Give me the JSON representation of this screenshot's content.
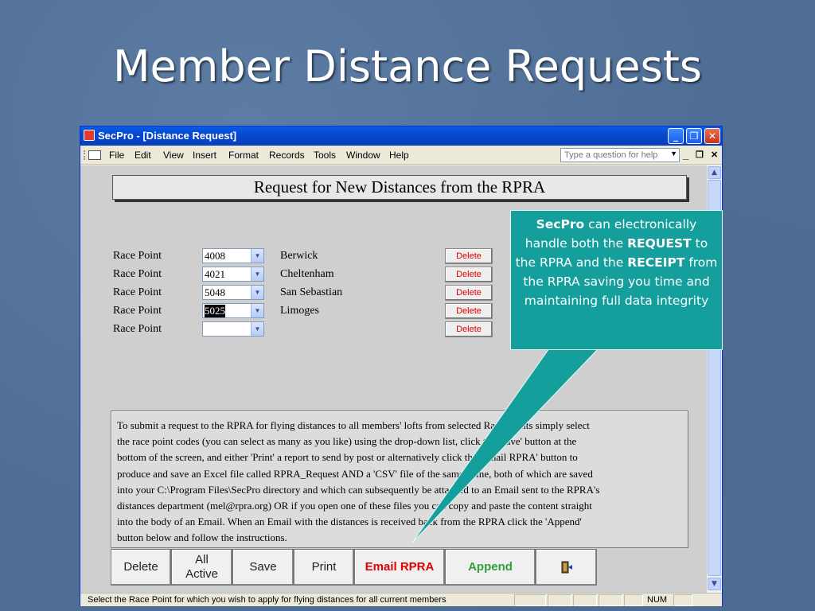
{
  "slide": {
    "title": "Member Distance Requests"
  },
  "window": {
    "title": "SecPro - [Distance Request]",
    "controls": {
      "minimize": "_",
      "restore": "❐",
      "close": "✕"
    }
  },
  "menu": {
    "items": [
      "File",
      "Edit",
      "View",
      "Insert",
      "Format",
      "Records",
      "Tools",
      "Window",
      "Help"
    ],
    "ask_placeholder": "Type a question for help",
    "mdi_minimize": "_",
    "mdi_restore": "❐",
    "mdi_close": "✕"
  },
  "form": {
    "header": "Request for New Distances from the RPRA",
    "rows": [
      {
        "label": "Race Point",
        "code": "4008",
        "name": "Berwick",
        "delete": "Delete"
      },
      {
        "label": "Race Point",
        "code": "4021",
        "name": "Cheltenham",
        "delete": "Delete"
      },
      {
        "label": "Race Point",
        "code": "5048",
        "name": "San Sebastian",
        "delete": "Delete"
      },
      {
        "label": "Race Point",
        "code": "5025",
        "name": "Limoges",
        "delete": "Delete"
      },
      {
        "label": "Race Point",
        "code": "",
        "name": "",
        "delete": "Delete"
      }
    ],
    "instructions": [
      "To submit a request to the RPRA for flying distances to all members' lofts from selected Race Points simply select",
      "the race point codes (you can select as many as you like) using the drop-down list, click the 'Save' button at the",
      "bottom of the screen, and either 'Print' a report to send by post or alternatively click the 'Email RPRA' button to",
      "produce and save an Excel file called RPRA_Request AND a 'CSV' file of the same name, both of which are saved",
      "into your C:\\Program Files\\SecPro directory and which can subsequently be attached to an Email sent to the RPRA's",
      "distances department (mel@rpra.org) OR if you open one of these files you can copy and paste the content straight",
      "into the body of an Email. When an Email with the distances is received back from the RPRA click the 'Append'",
      "button below and follow the instructions."
    ],
    "buttons": {
      "delete": "Delete",
      "all_active_line1": "All",
      "all_active_line2": "Active",
      "save": "Save",
      "print": "Print",
      "email": "Email RPRA",
      "append": "Append",
      "exit_icon": "exit-door-icon"
    },
    "colors": {
      "email": "#e00000",
      "append": "#2fa03a"
    }
  },
  "status": {
    "text": "Select the Race Point for which you wish to apply for flying distances for all current members",
    "num": "NUM"
  },
  "callout": {
    "part1_bold": "SecPro",
    "part1": " can electronically handle both the ",
    "part2_bold": "REQUEST",
    "part2": " to the RPRA and the ",
    "part3_bold": "RECEIPT",
    "part3": " from the RPRA saving you time and maintaining full data integrity",
    "color": "#149f9d"
  }
}
